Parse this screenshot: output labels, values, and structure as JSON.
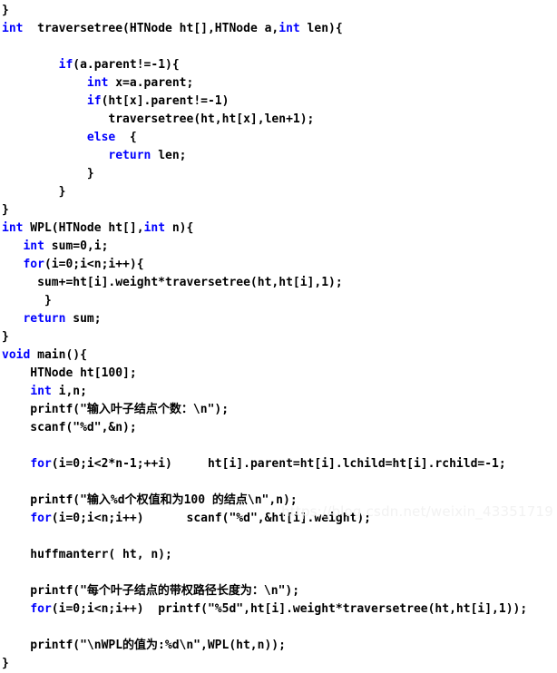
{
  "editor": {
    "background_color": "#ffffff",
    "text_color": "#000000",
    "keyword_color": "#0000ff",
    "font_size_px": 13,
    "line_height_px": 20,
    "language": "c"
  },
  "watermark": {
    "text": "https://blog.csdn.net/weixin_43351719",
    "color": "#f2f2f2"
  },
  "code": {
    "lines": [
      {
        "tokens": [
          {
            "t": "}",
            "k": false
          }
        ]
      },
      {
        "tokens": [
          {
            "t": "int",
            "k": true
          },
          {
            "t": "  traversetree(HTNode ht[],HTNode a,",
            "k": false
          },
          {
            "t": "int",
            "k": true
          },
          {
            "t": " len){",
            "k": false
          }
        ]
      },
      {
        "tokens": [
          {
            "t": "",
            "k": false
          }
        ]
      },
      {
        "tokens": [
          {
            "t": "        ",
            "k": false
          },
          {
            "t": "if",
            "k": true
          },
          {
            "t": "(a.parent!=-1){",
            "k": false
          }
        ]
      },
      {
        "tokens": [
          {
            "t": "            ",
            "k": false
          },
          {
            "t": "int",
            "k": true
          },
          {
            "t": " x=a.parent;",
            "k": false
          }
        ]
      },
      {
        "tokens": [
          {
            "t": "            ",
            "k": false
          },
          {
            "t": "if",
            "k": true
          },
          {
            "t": "(ht[x].parent!=-1)",
            "k": false
          }
        ]
      },
      {
        "tokens": [
          {
            "t": "               traversetree(ht,ht[x],len+1);",
            "k": false
          }
        ]
      },
      {
        "tokens": [
          {
            "t": "            ",
            "k": false
          },
          {
            "t": "else",
            "k": true
          },
          {
            "t": "  {",
            "k": false
          }
        ]
      },
      {
        "tokens": [
          {
            "t": "               ",
            "k": false
          },
          {
            "t": "return",
            "k": true
          },
          {
            "t": " len;",
            "k": false
          }
        ]
      },
      {
        "tokens": [
          {
            "t": "            }",
            "k": false
          }
        ]
      },
      {
        "tokens": [
          {
            "t": "        }",
            "k": false
          }
        ]
      },
      {
        "tokens": [
          {
            "t": "}",
            "k": false
          }
        ]
      },
      {
        "tokens": [
          {
            "t": "int",
            "k": true
          },
          {
            "t": " WPL(HTNode ht[],",
            "k": false
          },
          {
            "t": "int",
            "k": true
          },
          {
            "t": " n){",
            "k": false
          }
        ]
      },
      {
        "tokens": [
          {
            "t": "   ",
            "k": false
          },
          {
            "t": "int",
            "k": true
          },
          {
            "t": " sum=0,i;",
            "k": false
          }
        ]
      },
      {
        "tokens": [
          {
            "t": "   ",
            "k": false
          },
          {
            "t": "for",
            "k": true
          },
          {
            "t": "(i=0;i<n;i++){",
            "k": false
          }
        ]
      },
      {
        "tokens": [
          {
            "t": "     sum+=ht[i].weight*traversetree(ht,ht[i],1);",
            "k": false
          }
        ]
      },
      {
        "tokens": [
          {
            "t": "      }",
            "k": false
          }
        ]
      },
      {
        "tokens": [
          {
            "t": "   ",
            "k": false
          },
          {
            "t": "return",
            "k": true
          },
          {
            "t": " sum;",
            "k": false
          }
        ]
      },
      {
        "tokens": [
          {
            "t": "}",
            "k": false
          }
        ]
      },
      {
        "tokens": [
          {
            "t": "void",
            "k": true
          },
          {
            "t": " main(){",
            "k": false
          }
        ]
      },
      {
        "tokens": [
          {
            "t": "    HTNode ht[100];",
            "k": false
          }
        ]
      },
      {
        "tokens": [
          {
            "t": "    ",
            "k": false
          },
          {
            "t": "int",
            "k": true
          },
          {
            "t": " i,n;",
            "k": false
          }
        ]
      },
      {
        "tokens": [
          {
            "t": "    printf(\"输入叶子结点个数：\\n\");",
            "k": false
          }
        ]
      },
      {
        "tokens": [
          {
            "t": "    scanf(\"%d\",&n);",
            "k": false
          }
        ]
      },
      {
        "tokens": [
          {
            "t": "",
            "k": false
          }
        ]
      },
      {
        "tokens": [
          {
            "t": "    ",
            "k": false
          },
          {
            "t": "for",
            "k": true
          },
          {
            "t": "(i=0;i<2*n-1;++i)     ht[i].parent=ht[i].lchild=ht[i].rchild=-1;",
            "k": false
          }
        ]
      },
      {
        "tokens": [
          {
            "t": "",
            "k": false
          }
        ]
      },
      {
        "tokens": [
          {
            "t": "    printf(\"输入%d个权值和为100 的结点\\n\",n);",
            "k": false
          }
        ]
      },
      {
        "tokens": [
          {
            "t": "    ",
            "k": false
          },
          {
            "t": "for",
            "k": true
          },
          {
            "t": "(i=0;i<n;i++)      scanf(\"%d\",&ht[i].weight);",
            "k": false
          }
        ]
      },
      {
        "tokens": [
          {
            "t": "",
            "k": false
          }
        ]
      },
      {
        "tokens": [
          {
            "t": "    huffmanterr( ht, n);",
            "k": false
          }
        ]
      },
      {
        "tokens": [
          {
            "t": "",
            "k": false
          }
        ]
      },
      {
        "tokens": [
          {
            "t": "    printf(\"每个叶子结点的带权路径长度为：\\n\");",
            "k": false
          }
        ]
      },
      {
        "tokens": [
          {
            "t": "    ",
            "k": false
          },
          {
            "t": "for",
            "k": true
          },
          {
            "t": "(i=0;i<n;i++)  printf(\"%5d\",ht[i].weight*traversetree(ht,ht[i],1));",
            "k": false
          }
        ]
      },
      {
        "tokens": [
          {
            "t": "",
            "k": false
          }
        ]
      },
      {
        "tokens": [
          {
            "t": "    printf(\"\\nWPL的值为:%d\\n\",WPL(ht,n));",
            "k": false
          }
        ]
      },
      {
        "tokens": [
          {
            "t": "}",
            "k": false
          }
        ]
      }
    ]
  }
}
